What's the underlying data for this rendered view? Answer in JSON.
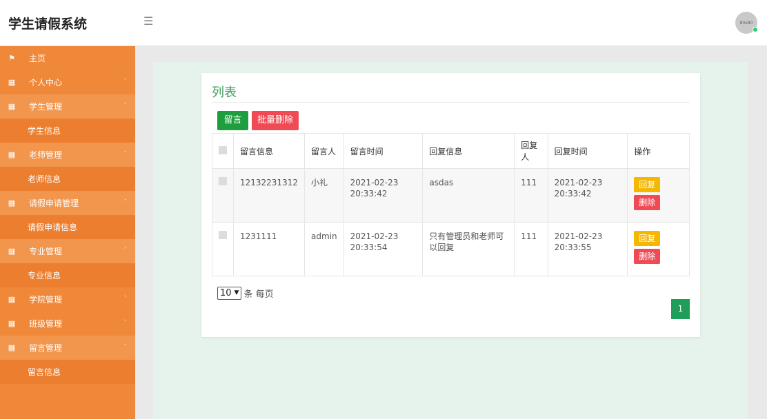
{
  "header": {
    "brand": "学生请假系统",
    "hamburger_icon": "menu-icon",
    "avatar_text": "80x80"
  },
  "sidebar": {
    "items": [
      {
        "label": "主页",
        "icon": "flag-icon",
        "type": "top"
      },
      {
        "label": "个人中心",
        "icon": "grid-icon",
        "type": "group",
        "caret": "down"
      },
      {
        "label": "学生管理",
        "icon": "grid-icon",
        "type": "group-open",
        "caret": "up"
      },
      {
        "label": "学生信息",
        "type": "sub"
      },
      {
        "label": "老师管理",
        "icon": "grid-icon",
        "type": "group-open",
        "caret": "up"
      },
      {
        "label": "老师信息",
        "type": "sub"
      },
      {
        "label": "请假申请管理",
        "icon": "grid-icon",
        "type": "group-open",
        "caret": "up"
      },
      {
        "label": "请假申请信息",
        "type": "sub"
      },
      {
        "label": "专业管理",
        "icon": "grid-icon",
        "type": "group-open",
        "caret": "up"
      },
      {
        "label": "专业信息",
        "type": "sub"
      },
      {
        "label": "学院管理",
        "icon": "grid-icon",
        "type": "group",
        "caret": "down"
      },
      {
        "label": "班级管理",
        "icon": "grid-icon",
        "type": "group",
        "caret": "down"
      },
      {
        "label": "留言管理",
        "icon": "grid-icon",
        "type": "group-open",
        "caret": "up"
      },
      {
        "label": "留言信息",
        "type": "sub"
      }
    ]
  },
  "main": {
    "title": "列表",
    "buttons": {
      "leave_message": "留言",
      "batch_delete": "批量删除"
    },
    "table": {
      "headers": [
        "留言信息",
        "留言人",
        "留言时间",
        "回复信息",
        "回复人",
        "回复时间",
        "操作"
      ],
      "rows": [
        {
          "message": "12132231312",
          "author": "小礼",
          "time": "2021-02-23 20:33:42",
          "reply": "asdas",
          "replier": "111",
          "reply_time": "2021-02-23 20:33:42",
          "actions": [
            "回复",
            "删除"
          ]
        },
        {
          "message": "1231111",
          "author": "admin",
          "time": "2021-02-23 20:33:54",
          "reply": "只有管理员和老师可以回复",
          "replier": "111",
          "reply_time": "2021-02-23 20:33:55",
          "actions": [
            "回复",
            "删除"
          ]
        }
      ]
    },
    "pagination": {
      "page_size": "10",
      "page_size_suffix": "条 每页",
      "current_page": "1"
    }
  },
  "colors": {
    "sidebar": "#f0883a",
    "accent_green": "#1e9e3e",
    "danger": "#f04b55",
    "warning": "#f6b700",
    "title_green": "#3e9d5c"
  }
}
